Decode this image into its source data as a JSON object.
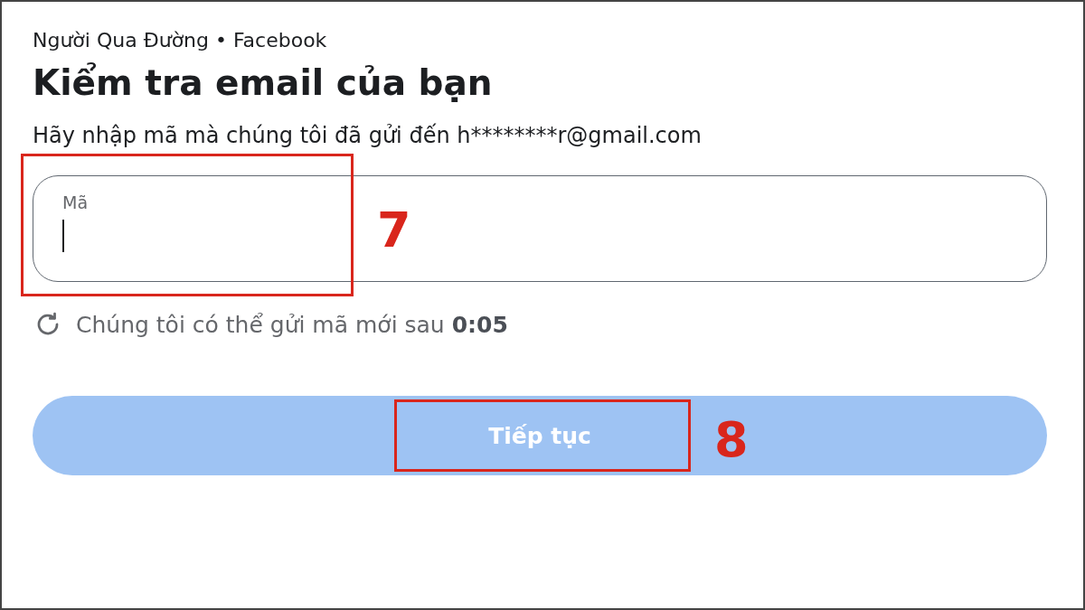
{
  "header": "Người Qua Đường • Facebook",
  "title": "Kiểm tra email của bạn",
  "description": "Hãy nhập mã mà chúng tôi đã gửi đến h********r@gmail.com",
  "code_field": {
    "label": "Mã",
    "focused": true,
    "annotation": "7"
  },
  "resend": {
    "text": "Chúng tôi có thể gửi mã mới sau **0:05**"
  },
  "continue_button": {
    "label": "Tiếp tục",
    "disabled": true,
    "annotation": "8"
  }
}
